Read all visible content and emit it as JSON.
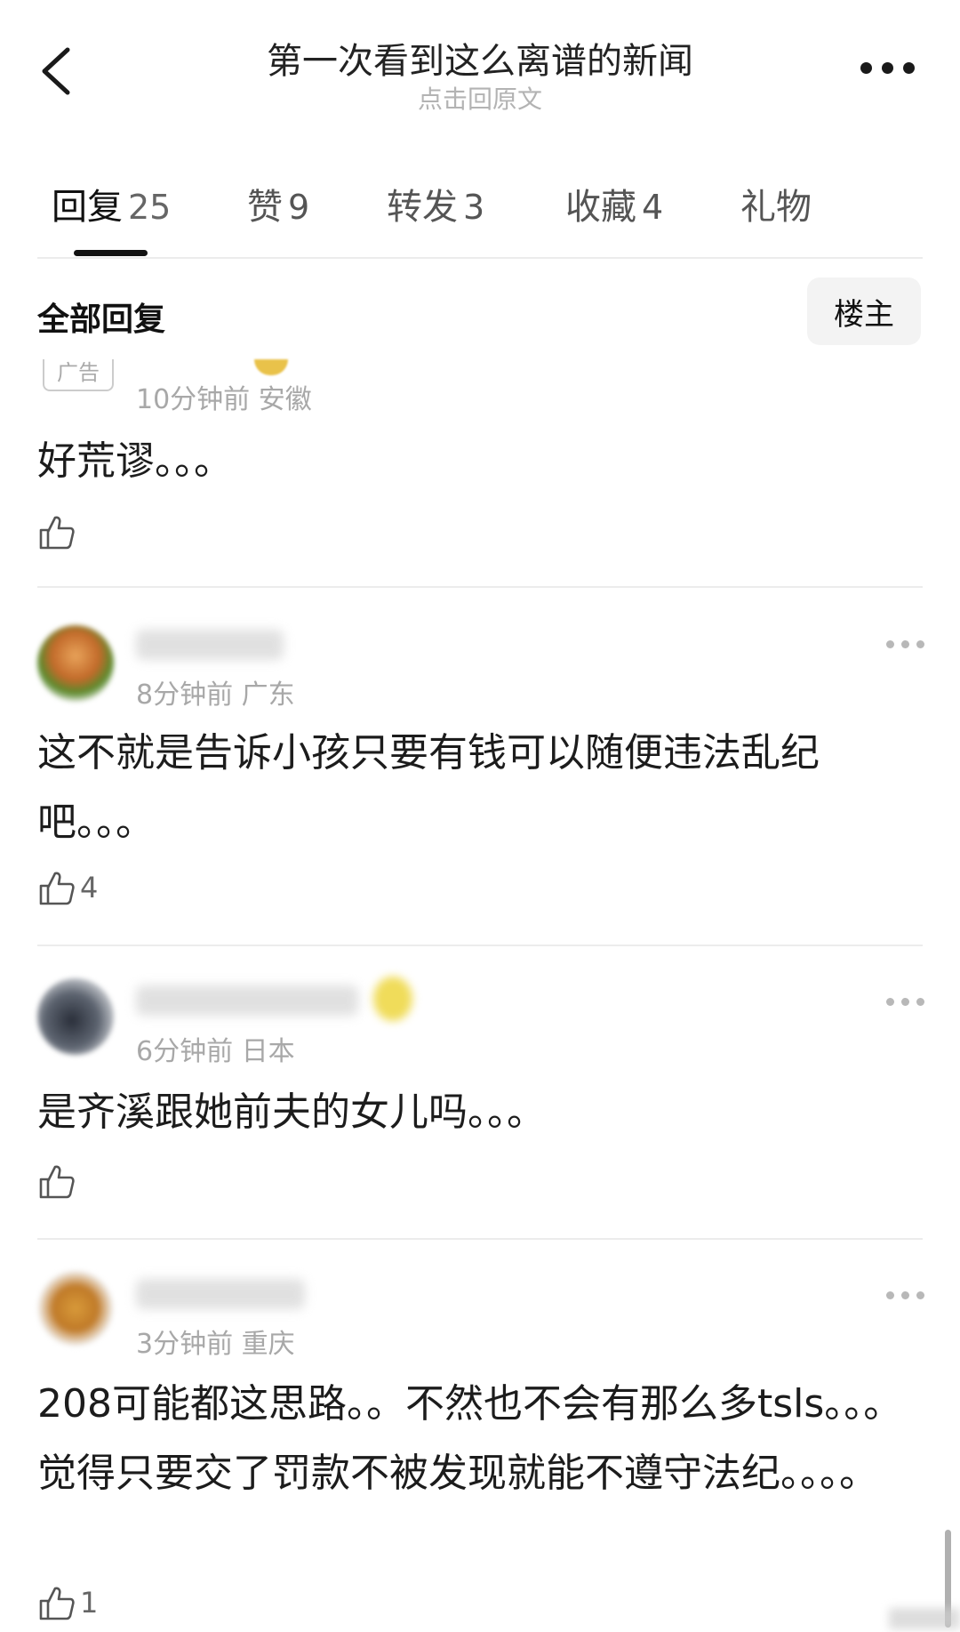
{
  "header": {
    "back_icon": "chevron-left-icon",
    "title": "第一次看到这么离谱的新闻",
    "subtitle": "点击回原文",
    "more_icon": "more-horizontal-icon"
  },
  "tabs": [
    {
      "label": "回复",
      "count": "25",
      "active": true
    },
    {
      "label": "赞",
      "count": "9"
    },
    {
      "label": "转发",
      "count": "3"
    },
    {
      "label": "收藏",
      "count": "4"
    },
    {
      "label": "礼物",
      "count": ""
    }
  ],
  "section": {
    "title": "全部回复",
    "owner_filter": "楼主"
  },
  "comments": [
    {
      "badge": "广告",
      "time": "10分钟前",
      "location": "安徽",
      "text": "好荒谬。。。",
      "likes": ""
    },
    {
      "time": "8分钟前",
      "location": "广东",
      "text": "这不就是告诉小孩只要有钱可以随便违法乱纪吧。。。",
      "likes": "4"
    },
    {
      "time": "6分钟前",
      "location": "日本",
      "text": "是齐溪跟她前夫的女儿吗。。。",
      "likes": ""
    },
    {
      "time": "3分钟前",
      "location": "重庆",
      "text": "208可能都这思路。。不然也不会有那么多tsls。。。觉得只要交了罚款不被发现就能不遵守法纪。。。。",
      "likes": "1"
    }
  ],
  "colors": {
    "text": "#1c1c1c",
    "meta": "#a8a8a8",
    "divider": "#ececec",
    "chip_bg": "#f3f3f3"
  }
}
